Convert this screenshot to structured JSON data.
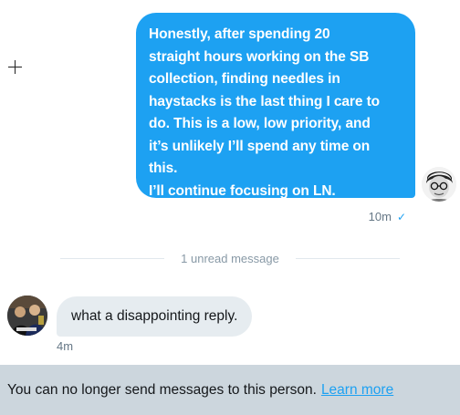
{
  "messages": {
    "outgoing": {
      "text": "Honestly, after spending 20\nstraight hours working on the SB\ncollection, finding needles in\nhaystacks is the last thing I care to\ndo. This is a low, low priority, and\nit’s unlikely I’ll spend any time on\nthis.\nI’ll continue focusing on LN.",
      "time": "10m",
      "read_icon": "check-icon"
    },
    "unread_divider": "1 unread message",
    "incoming": {
      "text": "what a disappointing reply.",
      "time": "4m"
    }
  },
  "footer": {
    "notice": "You can no longer send messages to this person.",
    "link": "Learn more"
  },
  "colors": {
    "accent": "#1da1f2",
    "incoming_bubble": "#e6ecf0",
    "footer_bg": "#ccd6dd"
  }
}
